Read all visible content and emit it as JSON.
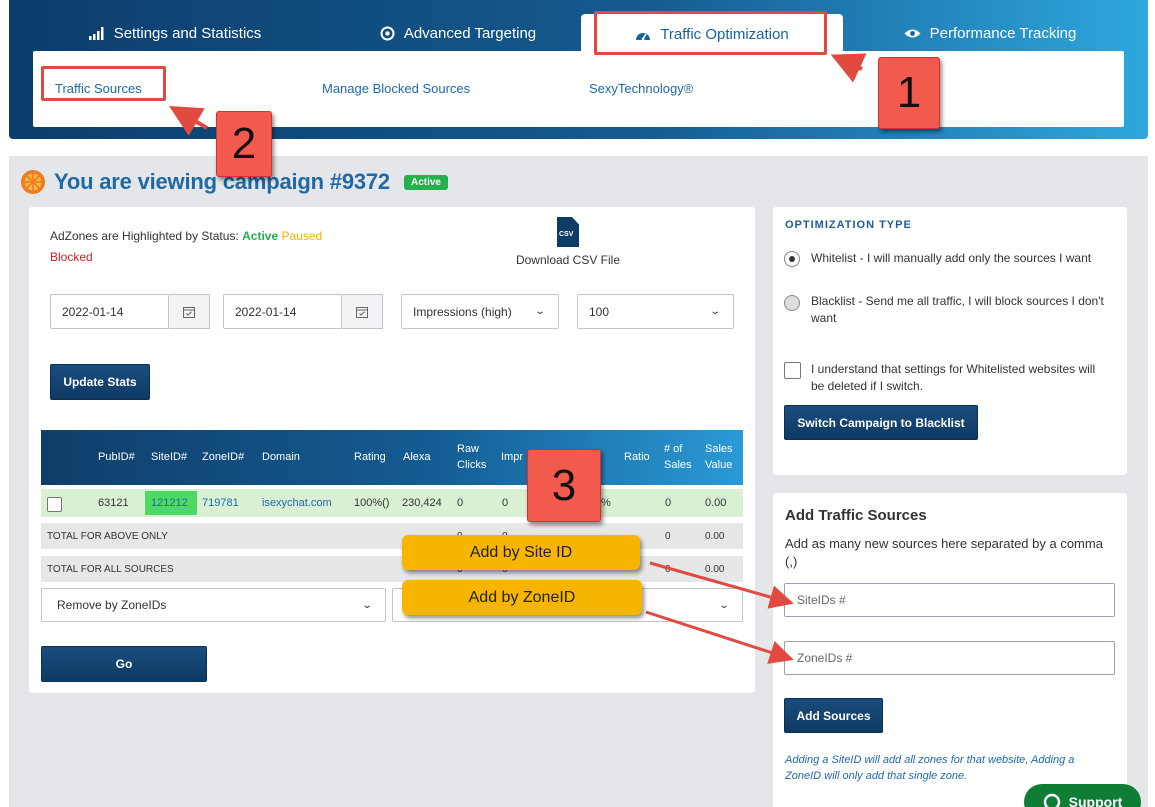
{
  "tabs": [
    {
      "label": "Settings and Statistics",
      "icon": "signal-bars-icon"
    },
    {
      "label": "Advanced Targeting",
      "icon": "target-icon"
    },
    {
      "label": "Traffic Optimization",
      "icon": "speedometer-icon"
    },
    {
      "label": "Performance Tracking",
      "icon": "eye-icon"
    }
  ],
  "subtabs": [
    "Traffic Sources",
    "Manage Blocked Sources",
    "SexyTechnology®"
  ],
  "campaign": {
    "title": "You are viewing campaign #9372",
    "status": "Active"
  },
  "legend": {
    "prefix": "AdZones are Highlighted by Status:",
    "active": "Active",
    "paused": "Paused",
    "blocked": "Blocked"
  },
  "csv": {
    "icon_text": "CSV",
    "label": "Download CSV File"
  },
  "filters": {
    "date_from": "2022-01-14",
    "date_to": "2022-01-14",
    "sort": "Impressions (high)",
    "limit": "100",
    "update_button": "Update Stats"
  },
  "table": {
    "headers": [
      "PubID#",
      "SiteID#",
      "ZoneID#",
      "Domain",
      "Rating",
      "Alexa",
      "Raw Clicks",
      "Impr",
      "Ratio",
      "# of Sales",
      "Sales Value"
    ],
    "row": {
      "pubid": "63121",
      "siteid": "121212",
      "zoneid": "719781",
      "domain": "isexychat.com",
      "rating": "100%()",
      "alexa": "230,424",
      "raw_clicks": "0",
      "impr": "0",
      "ratio_tail": "%",
      "sales": "0",
      "sales_value": "0.00"
    },
    "totals": [
      {
        "label": "TOTAL FOR ABOVE ONLY",
        "cols": [
          "0",
          "0",
          "0",
          "0.00"
        ]
      },
      {
        "label": "TOTAL FOR ALL SOURCES",
        "cols": [
          "0",
          "0",
          "0",
          "0.00"
        ]
      }
    ]
  },
  "actions": {
    "remove_select": "Remove by ZoneIDs",
    "go_button": "Go"
  },
  "optimization": {
    "title": "OPTIMIZATION TYPE",
    "whitelist": "Whitelist - I will manually add only the sources I want",
    "blacklist": "Blacklist - Send me all traffic, I will block sources I don't want",
    "understand": "I understand that settings for Whitelisted websites will be deleted if I switch.",
    "switch_button": "Switch Campaign to Blacklist"
  },
  "add_sources": {
    "title": "Add Traffic Sources",
    "description": "Add as many new sources here separated by a comma (,)",
    "siteids_placeholder": "SiteIDs #",
    "zoneids_placeholder": "ZoneIDs #",
    "button": "Add Sources",
    "note": "Adding a SiteID will add all zones for that website, Adding a ZoneID will only add that single zone."
  },
  "annotations": {
    "n1": "1",
    "n2": "2",
    "n3": "3",
    "add_site": "Add by Site ID",
    "add_zone": "Add by ZoneID"
  },
  "support": "Support",
  "colors": {
    "accent": "#1e6aa8",
    "active": "#22b14c",
    "paused": "#f0b400",
    "blocked": "#d81f1f",
    "annotation": "#e04a3f",
    "callout": "#f7b500"
  }
}
